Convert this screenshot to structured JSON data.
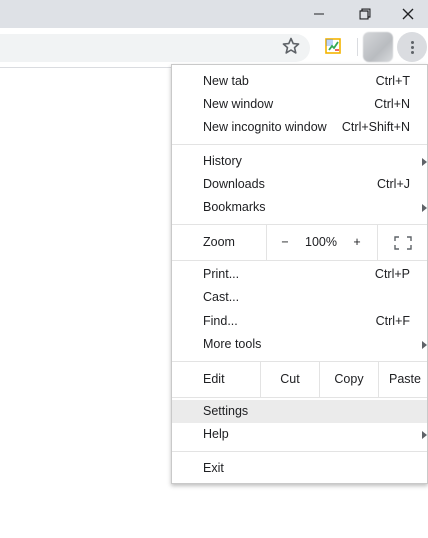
{
  "menu": {
    "group1": [
      {
        "label": "New tab",
        "shortcut": "Ctrl+T"
      },
      {
        "label": "New window",
        "shortcut": "Ctrl+N"
      },
      {
        "label": "New incognito window",
        "shortcut": "Ctrl+Shift+N"
      }
    ],
    "group2": [
      {
        "label": "History"
      },
      {
        "label": "Downloads",
        "shortcut": "Ctrl+J"
      },
      {
        "label": "Bookmarks"
      }
    ],
    "zoom": {
      "label": "Zoom",
      "minus": "−",
      "value": "100%",
      "plus": "+"
    },
    "group3": [
      {
        "label": "Print...",
        "shortcut": "Ctrl+P"
      },
      {
        "label": "Cast..."
      },
      {
        "label": "Find...",
        "shortcut": "Ctrl+F"
      },
      {
        "label": "More tools"
      }
    ],
    "edit": {
      "label": "Edit",
      "cut": "Cut",
      "copy": "Copy",
      "paste": "Paste"
    },
    "group4": [
      {
        "label": "Settings"
      },
      {
        "label": "Help"
      }
    ],
    "exit": {
      "label": "Exit"
    }
  },
  "icons": {
    "minimize": "minimize-icon",
    "restore": "restore-icon",
    "close": "close-icon",
    "bookmark_star": "star-icon",
    "extension": "extension-icon",
    "menu": "more-vert-icon",
    "fullscreen": "fullscreen-icon",
    "submenu": "chevron-right-icon"
  },
  "colors": {
    "highlight": "#ebebeb",
    "titlebar": "#dee1e6"
  }
}
